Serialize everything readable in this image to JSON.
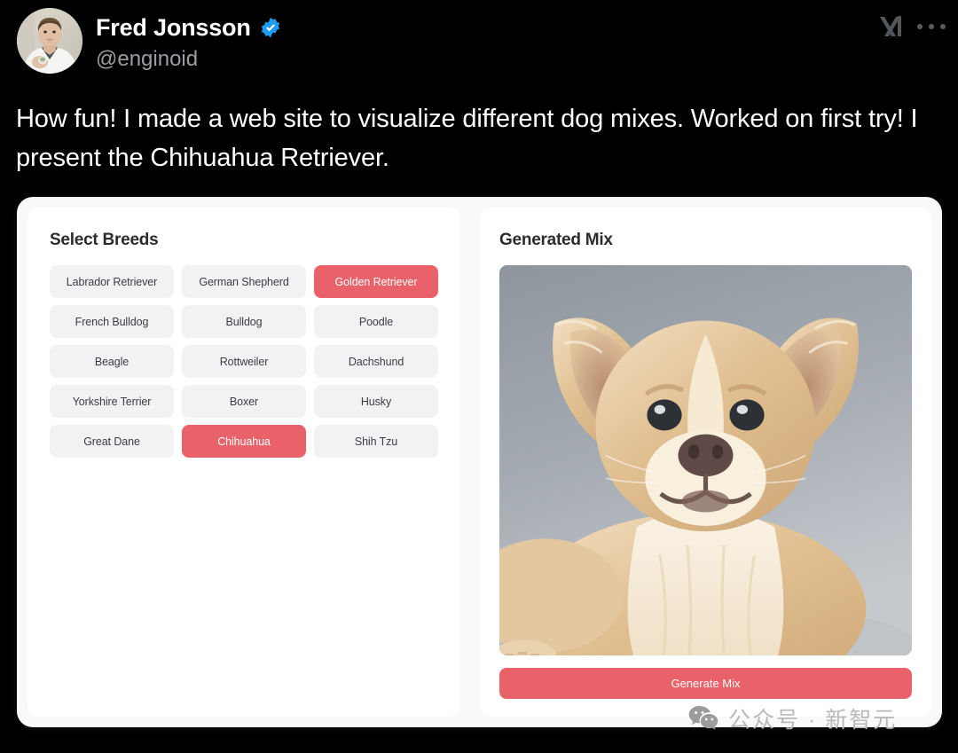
{
  "tweet": {
    "author": {
      "display_name": "Fred Jonsson",
      "handle": "@enginoid",
      "verified": true,
      "verified_color": "#1d9bf0"
    },
    "logo_label": "xAI",
    "more_label": "More options",
    "body": "How fun! I made a web site to visualize different dog mixes. Worked on first try! I present the Chihuahua Retriever."
  },
  "app": {
    "left_panel": {
      "title": "Select Breeds",
      "breeds": [
        {
          "label": "Labrador Retriever",
          "selected": false
        },
        {
          "label": "German Shepherd",
          "selected": false
        },
        {
          "label": "Golden Retriever",
          "selected": true
        },
        {
          "label": "French Bulldog",
          "selected": false
        },
        {
          "label": "Bulldog",
          "selected": false
        },
        {
          "label": "Poodle",
          "selected": false
        },
        {
          "label": "Beagle",
          "selected": false
        },
        {
          "label": "Rottweiler",
          "selected": false
        },
        {
          "label": "Dachshund",
          "selected": false
        },
        {
          "label": "Yorkshire Terrier",
          "selected": false
        },
        {
          "label": "Boxer",
          "selected": false
        },
        {
          "label": "Husky",
          "selected": false
        },
        {
          "label": "Great Dane",
          "selected": false
        },
        {
          "label": "Chihuahua",
          "selected": true
        },
        {
          "label": "Shih Tzu",
          "selected": false
        }
      ]
    },
    "right_panel": {
      "title": "Generated Mix",
      "image_alt": "Tan and cream long-eared mixed-breed dog lying down on a light gray background",
      "generate_label": "Generate Mix"
    },
    "colors": {
      "accent": "#e96169",
      "chip_background": "#f1f2f4",
      "chip_text": "#3b3d44",
      "card_background": "#ffffff",
      "frame_background": "#f8f9fb"
    }
  },
  "watermark": {
    "text": "公众号 · 新智元",
    "icon": "wechat-icon"
  }
}
